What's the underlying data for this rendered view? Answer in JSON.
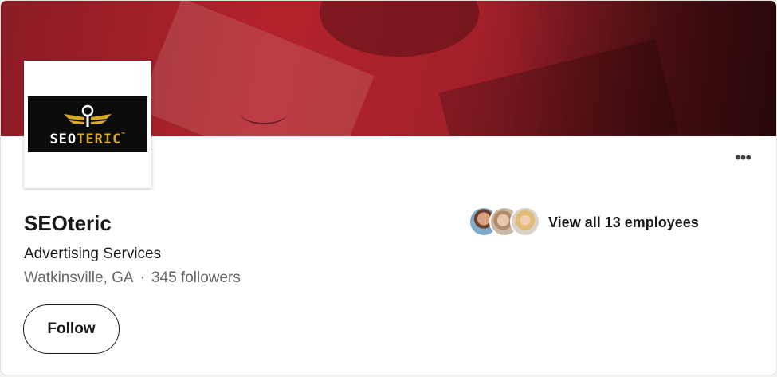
{
  "company": {
    "name": "SEOteric",
    "industry": "Advertising Services",
    "location": "Watkinsville, GA",
    "separator": "·",
    "followers": "345 followers"
  },
  "logo": {
    "text_white": "SEO",
    "text_gold": "TERIC",
    "trademark": "™"
  },
  "actions": {
    "follow_label": "Follow",
    "more_label": "•••"
  },
  "employees": {
    "label": "View all 13 employees"
  },
  "colors": {
    "cover_red": "#b4232c",
    "logo_gold": "#d6a92d",
    "text_primary": "#191919",
    "text_secondary": "#666666"
  },
  "icons": {
    "more": "more-horizontal-icon",
    "logo_emblem": "winged-emblem-icon"
  }
}
